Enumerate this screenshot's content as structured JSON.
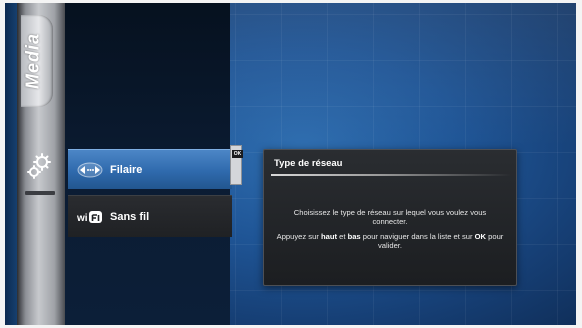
{
  "sidebar": {
    "section_label": "Media",
    "gear_icon": "settings-gear-icon"
  },
  "menu": {
    "items": [
      {
        "label": "Filaire",
        "icon": "ethernet-arrows-icon",
        "selected": true
      },
      {
        "label": "Sans fil",
        "icon": "wifi-icon",
        "icon_text": "wi",
        "selected": false
      }
    ],
    "ok_badge": "OK"
  },
  "panel": {
    "title": "Type de réseau",
    "line1": "Choisissez le type de réseau sur lequel vous voulez vous connecter.",
    "line2_a": "Appuyez sur ",
    "line2_haut": "haut",
    "line2_b": " et ",
    "line2_bas": "bas",
    "line2_c": " pour naviguer dans la liste et sur ",
    "line2_ok": "OK",
    "line2_d": " pour valider."
  },
  "colors": {
    "background_blue": "#1f5596",
    "selected_item": "#2f6aad",
    "panel_bg": "#1c1e21"
  }
}
